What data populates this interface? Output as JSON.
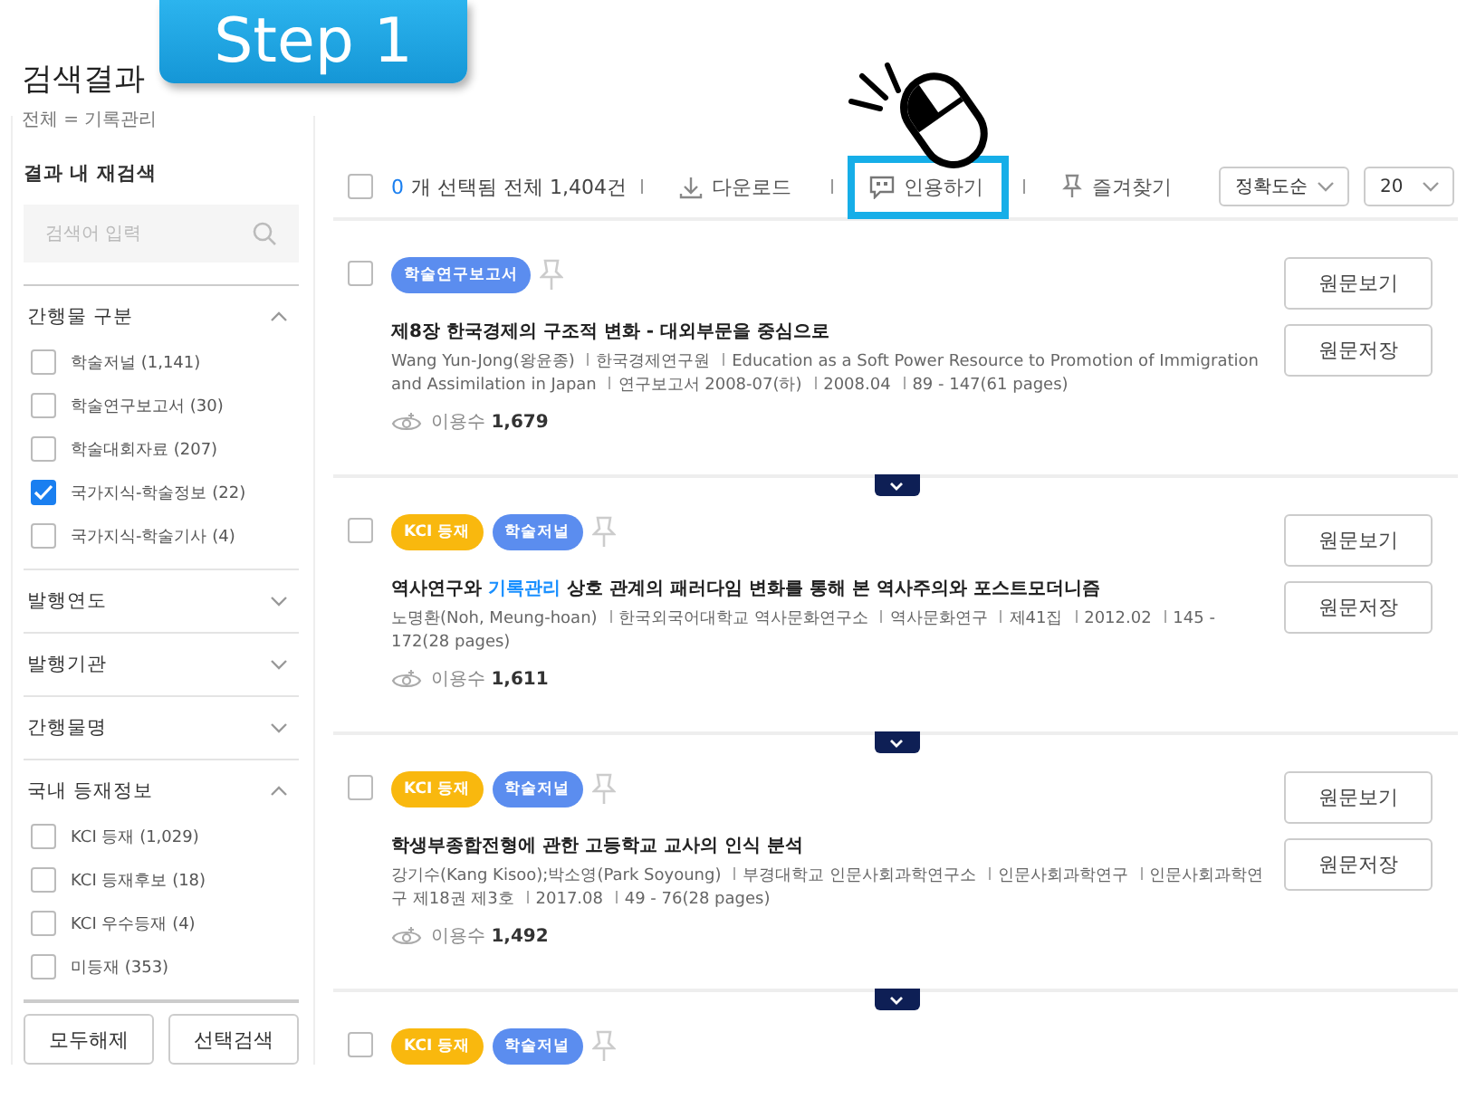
{
  "step_badge": {
    "text": "Step 1"
  },
  "header": {
    "title": "검색결과",
    "subtitle": "전체 = 기록관리"
  },
  "sidebar": {
    "refine_label": "결과 내 재검색",
    "search": {
      "placeholder": "검색어 입력"
    },
    "sections": [
      {
        "title": "간행물 구분",
        "expanded": true,
        "options": [
          {
            "label": "학술저널 (1,141)",
            "checked": false
          },
          {
            "label": "학술연구보고서 (30)",
            "checked": false
          },
          {
            "label": "학술대회자료 (207)",
            "checked": false
          },
          {
            "label": "국가지식-학술정보 (22)",
            "checked": true
          },
          {
            "label": "국가지식-학술기사 (4)",
            "checked": false
          }
        ]
      },
      {
        "title": "발행연도",
        "expanded": false
      },
      {
        "title": "발행기관",
        "expanded": false
      },
      {
        "title": "간행물명",
        "expanded": false
      },
      {
        "title": "국내 등재정보",
        "expanded": true,
        "options": [
          {
            "label": "KCI 등재 (1,029)",
            "checked": false
          },
          {
            "label": "KCI 등재후보 (18)",
            "checked": false
          },
          {
            "label": "KCI 우수등재 (4)",
            "checked": false
          },
          {
            "label": "미등재 (353)",
            "checked": false
          }
        ]
      }
    ],
    "buttons": [
      "모두해제",
      "선택검색"
    ]
  },
  "toolbar": {
    "select_all_checked": false,
    "selected_count": "0",
    "summary": "개 선택됨 전체 1,404건",
    "actions": [
      {
        "label": "다운로드",
        "kind": "download",
        "highlighted": false
      },
      {
        "label": "인용하기",
        "kind": "cite",
        "highlighted": true
      },
      {
        "label": "즐겨찾기",
        "kind": "favorite",
        "highlighted": false
      }
    ],
    "sort": "정확도순",
    "page_size": "20"
  },
  "results": [
    {
      "checked": false,
      "tags": [
        {
          "label": "학술연구보고서",
          "color": "#5b8def"
        }
      ],
      "title": [
        {
          "text": "제8장 한국경제의 구조적 변화 - 대외부문을 중심으로",
          "highlight": false
        }
      ],
      "meta": [
        "Wang Yun-Jong(왕윤종)",
        "한국경제연구원",
        "Education as a Soft Power Resource to Promotion of Immigration and Assimilation in Japan",
        "연구보고서 2008-07(하)",
        "2008.04",
        "89 - 147(61 pages)"
      ],
      "views_label": "이용수",
      "views": "1,679",
      "buttons": [
        "원문보기",
        "원문저장"
      ]
    },
    {
      "checked": false,
      "tags": [
        {
          "label": "KCI 등재",
          "color": "#f9b80e"
        },
        {
          "label": "학술저널",
          "color": "#5b8def"
        }
      ],
      "title": [
        {
          "text": "역사연구와 ",
          "highlight": false
        },
        {
          "text": "기록관리",
          "highlight": true
        },
        {
          "text": " 상호 관계의 패러다임 변화를 통해 본 역사주의와 포스트모더니즘",
          "highlight": false
        }
      ],
      "meta": [
        "노명환(Noh, Meung-hoan)",
        "한국외국어대학교 역사문화연구소",
        "역사문화연구",
        "제41집",
        "2012.02",
        "145 - 172(28 pages)"
      ],
      "views_label": "이용수",
      "views": "1,611",
      "buttons": [
        "원문보기",
        "원문저장"
      ]
    },
    {
      "checked": false,
      "tags": [
        {
          "label": "KCI 등재",
          "color": "#f9b80e"
        },
        {
          "label": "학술저널",
          "color": "#5b8def"
        }
      ],
      "title": [
        {
          "text": "학생부종합전형에 관한 고등학교 교사의 인식 분석",
          "highlight": false
        }
      ],
      "meta": [
        "강기수(Kang Kisoo);박소영(Park Soyoung)",
        "부경대학교 인문사회과학연구소",
        "인문사회과학연구",
        "인문사회과학연구 제18권 제3호",
        "2017.08",
        "49 - 76(28 pages)"
      ],
      "views_label": "이용수",
      "views": "1,492",
      "buttons": [
        "원문보기",
        "원문저장"
      ]
    },
    {
      "checked": false,
      "tags": [
        {
          "label": "KCI 등재",
          "color": "#f9b80e"
        },
        {
          "label": "학술저널",
          "color": "#5b8def"
        }
      ]
    }
  ]
}
